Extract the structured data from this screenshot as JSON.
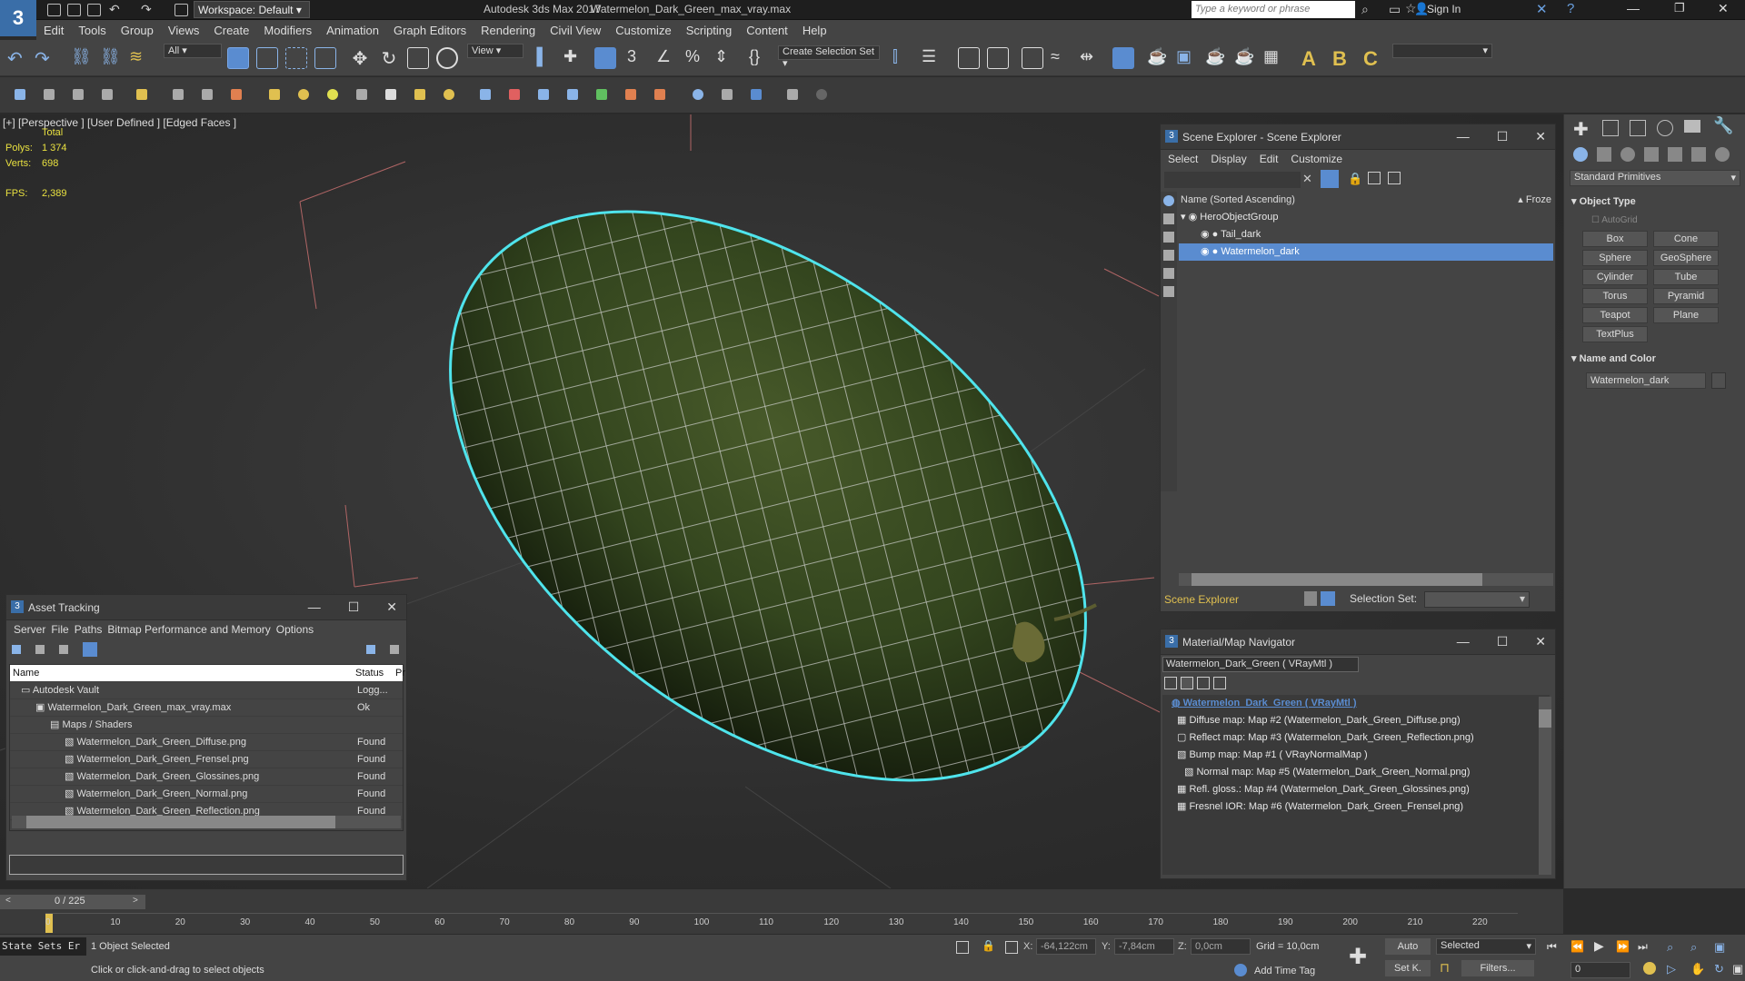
{
  "titlebar": {
    "workspace": "Workspace: Default",
    "app_title": "Autodesk 3ds Max 2017",
    "file_title": "Watermelon_Dark_Green_max_vray.max",
    "search_placeholder": "Type a keyword or phrase",
    "sign_in": "Sign In",
    "logo": "3"
  },
  "menu": [
    "Edit",
    "Tools",
    "Group",
    "Views",
    "Create",
    "Modifiers",
    "Animation",
    "Graph Editors",
    "Rendering",
    "Civil View",
    "Customize",
    "Scripting",
    "Content",
    "Help"
  ],
  "toolbar": {
    "filter": "All",
    "view": "View",
    "selection_set": "Create Selection Set"
  },
  "viewport": {
    "label": "[+] [Perspective ] [User Defined ] [Edged Faces ]",
    "total": "Total",
    "polys_label": "Polys:",
    "polys": "1 374",
    "verts_label": "Verts:",
    "verts": "698",
    "fps_label": "FPS:",
    "fps": "2,389"
  },
  "scene_explorer": {
    "title": "Scene Explorer - Scene Explorer",
    "menu": [
      "Select",
      "Display",
      "Edit",
      "Customize"
    ],
    "col_name": "Name (Sorted Ascending)",
    "col_frozen": "▴ Froze",
    "items": [
      {
        "name": "HeroObjectGroup",
        "level": 0
      },
      {
        "name": "Tail_dark",
        "level": 1
      },
      {
        "name": "Watermelon_dark",
        "level": 1
      }
    ],
    "footer": "Scene Explorer",
    "selection_set_label": "Selection Set:"
  },
  "command_panel": {
    "dropdown": "Standard Primitives",
    "object_type": "Object Type",
    "autogrid": "AutoGrid",
    "buttons": [
      "Box",
      "Cone",
      "Sphere",
      "GeoSphere",
      "Cylinder",
      "Tube",
      "Torus",
      "Pyramid",
      "Teapot",
      "Plane",
      "TextPlus"
    ],
    "name_color": "Name and Color",
    "object_name": "Watermelon_dark"
  },
  "asset_tracking": {
    "title": "Asset Tracking",
    "menu": [
      "Server",
      "File",
      "Paths",
      "Bitmap Performance and Memory",
      "Options"
    ],
    "col_name": "Name",
    "col_status": "Status",
    "col_p": "Pr",
    "rows": [
      {
        "name": "Autodesk Vault",
        "status": "Logg...",
        "level": 0
      },
      {
        "name": "Watermelon_Dark_Green_max_vray.max",
        "status": "Ok",
        "level": 1
      },
      {
        "name": "Maps / Shaders",
        "status": "",
        "level": 2
      },
      {
        "name": "Watermelon_Dark_Green_Diffuse.png",
        "status": "Found",
        "level": 3
      },
      {
        "name": "Watermelon_Dark_Green_Frensel.png",
        "status": "Found",
        "level": 3
      },
      {
        "name": "Watermelon_Dark_Green_Glossines.png",
        "status": "Found",
        "level": 3
      },
      {
        "name": "Watermelon_Dark_Green_Normal.png",
        "status": "Found",
        "level": 3
      },
      {
        "name": "Watermelon_Dark_Green_Reflection.png",
        "status": "Found",
        "level": 3
      }
    ]
  },
  "material_nav": {
    "title": "Material/Map Navigator",
    "field": "Watermelon_Dark_Green  ( VRayMtl )",
    "items": [
      {
        "text": "Watermelon_Dark_Green  ( VRayMtl )",
        "level": 0
      },
      {
        "text": "Diffuse map: Map #2 (Watermelon_Dark_Green_Diffuse.png)",
        "level": 1
      },
      {
        "text": "Reflect map: Map #3 (Watermelon_Dark_Green_Reflection.png)",
        "level": 1
      },
      {
        "text": "Bump map: Map #1  ( VRayNormalMap )",
        "level": 1
      },
      {
        "text": "Normal map: Map #5 (Watermelon_Dark_Green_Normal.png)",
        "level": 2
      },
      {
        "text": "Refl. gloss.: Map #4 (Watermelon_Dark_Green_Glossines.png)",
        "level": 1
      },
      {
        "text": "Fresnel IOR: Map #6 (Watermelon_Dark_Green_Frensel.png)",
        "level": 1
      }
    ]
  },
  "timeline": {
    "frame": "0 / 225",
    "ticks": [
      "0",
      "10",
      "20",
      "30",
      "40",
      "50",
      "60",
      "70",
      "80",
      "90",
      "100",
      "110",
      "120",
      "130",
      "140",
      "150",
      "160",
      "170",
      "180",
      "190",
      "200",
      "210",
      "220"
    ]
  },
  "status": {
    "state_sets": "State Sets Er",
    "selected": "1 Object Selected",
    "hint": "Click or click-and-drag to select objects",
    "x_label": "X:",
    "x": "-64,122cm",
    "y_label": "Y:",
    "y": "-7,84cm",
    "z_label": "Z:",
    "z": "0,0cm",
    "grid": "Grid = 10,0cm",
    "add_time_tag": "Add Time Tag",
    "auto": "Auto",
    "selected_dd": "Selected",
    "set_k": "Set K.",
    "filters": "Filters...",
    "frame_field": "0"
  }
}
